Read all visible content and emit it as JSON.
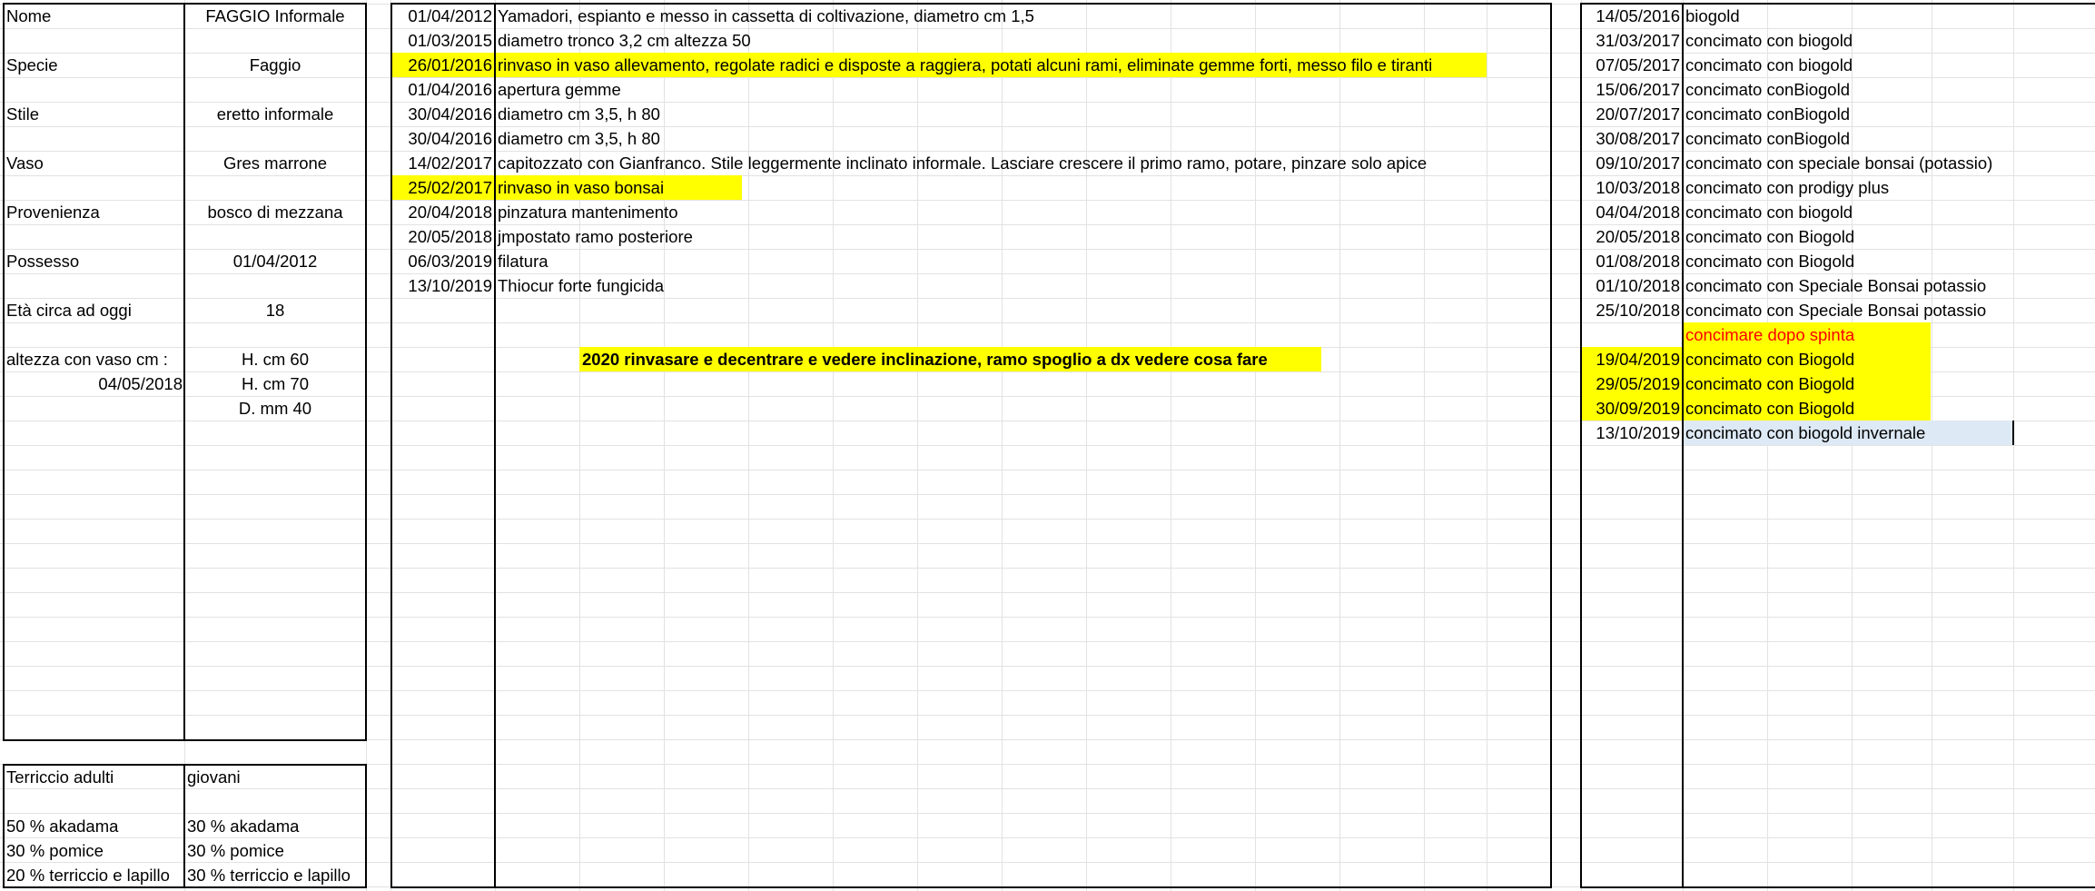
{
  "colors": {
    "highlight": "#ffff00",
    "light_blue": "#dde9f5",
    "red_text": "#ff0000",
    "grid": "#e2e2e2"
  },
  "info": {
    "rows": [
      {
        "label": "Nome",
        "value": "FAGGIO Informale"
      },
      {
        "label": "Specie",
        "value": "Faggio"
      },
      {
        "label": "Stile",
        "value": "eretto informale"
      },
      {
        "label": "Vaso",
        "value": "Gres marrone"
      },
      {
        "label": "Provenienza",
        "value": "bosco di mezzana"
      },
      {
        "label": "Possesso",
        "value": "01/04/2012"
      },
      {
        "label": "Età circa ad oggi",
        "value": "18"
      }
    ],
    "height": {
      "label": "altezza con vaso cm :",
      "value": "H. cm 60",
      "date": "04/05/2018",
      "value2": "H. cm 70",
      "value3": "D. mm 40"
    }
  },
  "soil": {
    "header_adults": "Terriccio adulti",
    "header_young": "giovani",
    "rows": [
      {
        "adults": "50 % akadama",
        "young": "30 % akadama"
      },
      {
        "adults": "30 % pomice",
        "young": "30 % pomice"
      },
      {
        "adults": "20 % terriccio e lapillo",
        "young": "30 % terriccio e lapillo"
      }
    ]
  },
  "history": {
    "entries": [
      {
        "date": "01/04/2012",
        "text": "Yamadori, espianto e messo in cassetta di coltivazione, diametro cm 1,5"
      },
      {
        "date": "01/03/2015",
        "text": " diametro tronco 3,2 cm altezza 50"
      },
      {
        "date": "26/01/2016",
        "text": "rinvaso in vaso allevamento, regolate radici e disposte a raggiera, potati alcuni rami, eliminate gemme forti, messo filo e tiranti"
      },
      {
        "date": "01/04/2016",
        "text": "apertura gemme"
      },
      {
        "date": "30/04/2016",
        "text": "diametro cm 3,5,  h 80"
      },
      {
        "date": "30/04/2016",
        "text": "diametro cm 3,5,  h 80"
      },
      {
        "date": "14/02/2017",
        "text": "capitozzato con Gianfranco.  Stile leggermente inclinato informale. Lasciare crescere il primo ramo,  potare, pinzare solo apice"
      },
      {
        "date": "25/02/2017",
        "text": "rinvaso in vaso bonsai"
      },
      {
        "date": "20/04/2018",
        "text": "pinzatura mantenimento"
      },
      {
        "date": "20/05/2018",
        "text": "jmpostato ramo posteriore"
      },
      {
        "date": "06/03/2019",
        "text": "filatura"
      },
      {
        "date": "13/10/2019",
        "text": "Thiocur forte fungicida"
      }
    ],
    "note": "2020 rinvasare e decentrare e vedere inclinazione, ramo spoglio a dx vedere cosa fare"
  },
  "fertilizer": {
    "entries": [
      {
        "date": "14/05/2016",
        "text": "biogold"
      },
      {
        "date": "31/03/2017",
        "text": "concimato con biogold"
      },
      {
        "date": "07/05/2017",
        "text": "concimato con biogold"
      },
      {
        "date": "15/06/2017",
        "text": "concimato conBiogold"
      },
      {
        "date": "20/07/2017",
        "text": "concimato conBiogold"
      },
      {
        "date": "30/08/2017",
        "text": "concimato conBiogold"
      },
      {
        "date": "09/10/2017",
        "text": "concimato con speciale bonsai (potassio)"
      },
      {
        "date": "10/03/2018",
        "text": "concimato con prodigy plus"
      },
      {
        "date": "04/04/2018",
        "text": "concimato con biogold"
      },
      {
        "date": "20/05/2018",
        "text": "concimato con Biogold"
      },
      {
        "date": "01/08/2018",
        "text": "concimato con Biogold"
      },
      {
        "date": "01/10/2018",
        "text": "concimato con Speciale Bonsai potassio"
      },
      {
        "date": "25/10/2018",
        "text": "concimato con Speciale Bonsai potassio"
      },
      {
        "date": "",
        "text": "concimare dopo spinta"
      },
      {
        "date": "19/04/2019",
        "text": "concimato con Biogold"
      },
      {
        "date": "29/05/2019",
        "text": "concimato con Biogold"
      },
      {
        "date": "30/09/2019",
        "text": "concimato con Biogold"
      },
      {
        "date": "13/10/2019",
        "text": "concimato con biogold invernale"
      }
    ]
  }
}
